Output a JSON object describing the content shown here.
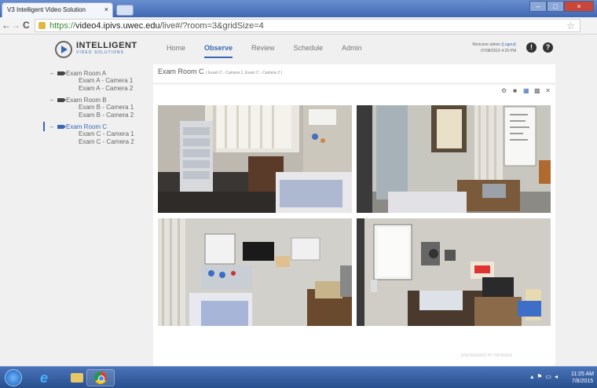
{
  "browser": {
    "tab_title": "V3 Intelligent Video Solution",
    "tab_close": "×",
    "url_scheme": "https://",
    "url_host": "video4.ipivs.uwec.edu",
    "url_path": "/live#/?room=3&gridSize=4"
  },
  "app": {
    "logo_line1": "INTELLIGENT",
    "logo_line2": "VIDEO SOLUTIONS",
    "menu": [
      {
        "label": "Home"
      },
      {
        "label": "Observe",
        "active": true
      },
      {
        "label": "Review"
      },
      {
        "label": "Schedule"
      },
      {
        "label": "Admin"
      }
    ],
    "welcome": "Welcome admin",
    "logout": "(Logout)",
    "datetime": "07/08/2015 4:25 PM"
  },
  "sidebar": {
    "rooms": [
      {
        "name": "Exam Room A",
        "cameras": [
          "Exam A - Camera 1",
          "Exam A - Camera 2"
        ]
      },
      {
        "name": "Exam Room B",
        "cameras": [
          "Exam B - Camera 1",
          "Exam B - Camera 2"
        ]
      },
      {
        "name": "Exam Room C",
        "selected": true,
        "cameras": [
          "Exam C - Camera 1",
          "Exam C - Camera 2"
        ]
      }
    ]
  },
  "main": {
    "room_title": "Exam Room C",
    "room_cameras": "( Exam C - Camera 1, Exam C - Camera 2 )",
    "view_icons": [
      "gear-icon",
      "grid-1-icon",
      "grid-4-icon",
      "grid-9-icon",
      "fullscreen-icon"
    ],
    "watermark": "ENGINEERED BY WONDER"
  },
  "taskbar": {
    "time": "11:25 AM",
    "date": "7/8/2015"
  },
  "colors": {
    "accent": "#3a67b5",
    "title_bar": "#3f67b3"
  }
}
